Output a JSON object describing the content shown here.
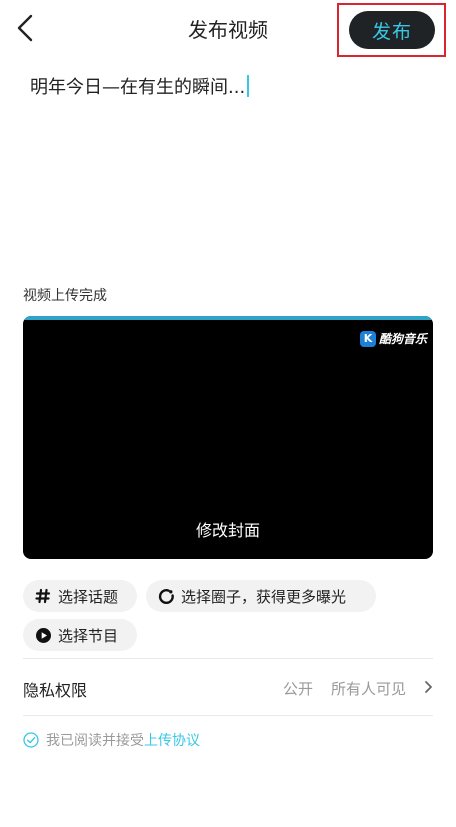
{
  "header": {
    "title": "发布视频",
    "publish_label": "发布"
  },
  "caption": {
    "text": "明年今日—在有生的瞬间..."
  },
  "upload": {
    "status": "视频上传完成",
    "progress": 1.0
  },
  "video": {
    "watermark_logo": "K",
    "watermark_text": "酷狗音乐",
    "cover_label": "修改封面"
  },
  "chips": {
    "topic": "选择话题",
    "circle": "选择圈子，获得更多曝光",
    "program": "选择节目"
  },
  "privacy": {
    "label": "隐私权限",
    "value1": "公开",
    "value2": "所有人可见"
  },
  "agreement": {
    "prefix": "我已阅读并接受",
    "link": "上传协议"
  },
  "colors": {
    "accent": "#38c8e6",
    "publish_bg": "#1f2326",
    "highlight_border": "#d8262e"
  }
}
